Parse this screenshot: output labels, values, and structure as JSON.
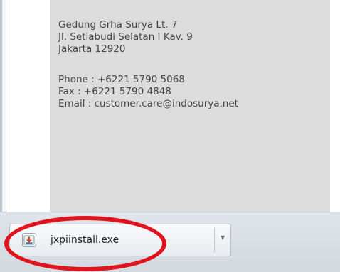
{
  "address": {
    "lines": [
      "Gedung Grha Surya Lt. 7",
      "Jl. Setiabudi Selatan I Kav. 9",
      "Jakarta 12920"
    ]
  },
  "contact": {
    "phone": "Phone : +6221 5790 5068",
    "fax": "Fax : +6221 5790 4848",
    "email": "Email : customer.care@indosurya.net"
  },
  "download_bar": {
    "file_name": "jxpiinstall.exe",
    "file_icon": "installer-icon",
    "dropdown_icon": "chevron-down-icon"
  },
  "annotation": {
    "color": "#e0141c"
  }
}
